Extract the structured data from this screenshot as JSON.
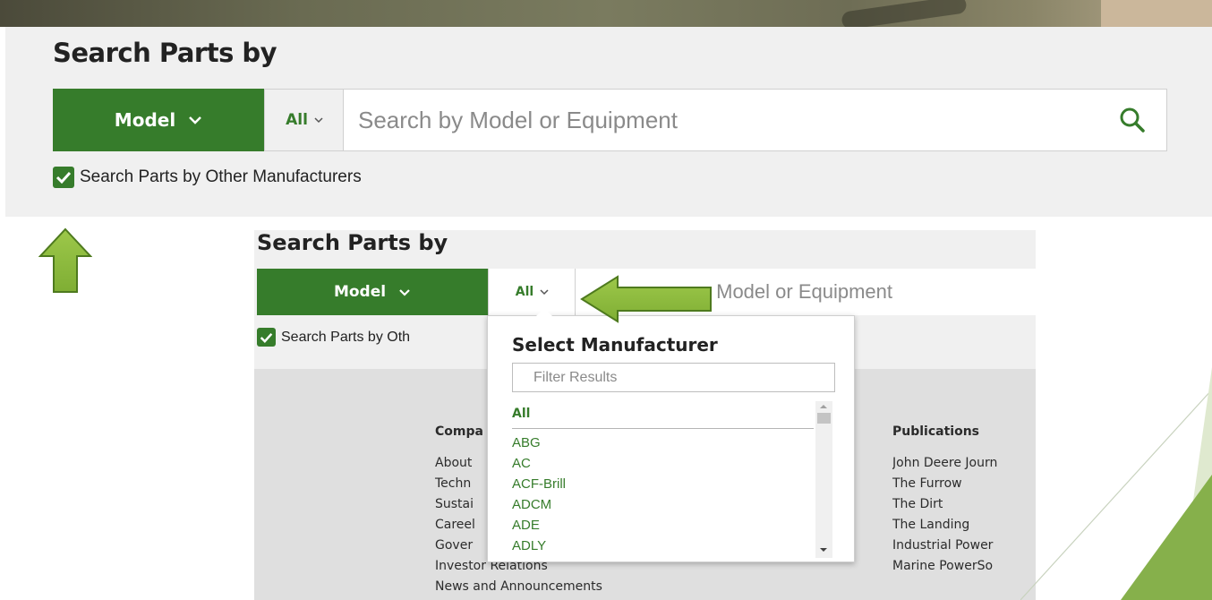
{
  "panel1": {
    "title": "Search Parts by",
    "model_label": "Model",
    "all_label": "All",
    "search_placeholder": "Search by Model or Equipment",
    "checkbox_label": "Search Parts by Other Manufacturers",
    "checkbox_checked": true
  },
  "panel2": {
    "title": "Search Parts by",
    "model_label": "Model",
    "all_label": "All",
    "search_placeholder_visible": "y Model or Equipment",
    "checkbox_label_visible": "Search Parts by Oth"
  },
  "dropdown": {
    "title": "Select Manufacturer",
    "filter_placeholder": "Filter Results",
    "options": [
      "All",
      "ABG",
      "AC",
      "ACF-Brill",
      "ADCM",
      "ADE",
      "ADLY"
    ]
  },
  "footer": {
    "company_heading": "Compa",
    "company_items": [
      "About",
      "Techn",
      "Sustai",
      "Careel",
      "Gover",
      "Investor Relations",
      "News and Announcements"
    ],
    "publications_heading": "Publications",
    "publications_items": [
      "John Deere Journ",
      "The Furrow",
      "The Dirt",
      "The Landing",
      "Industrial Power",
      "Marine PowerSo"
    ]
  },
  "colors": {
    "brand_green": "#367c2b",
    "arrow_green": "#8ab83c",
    "panel_gray": "#f0f0f0"
  },
  "icons": [
    "search-icon",
    "chevron-down-icon",
    "checkmark-icon",
    "arrow-up-icon",
    "arrow-left-icon"
  ]
}
